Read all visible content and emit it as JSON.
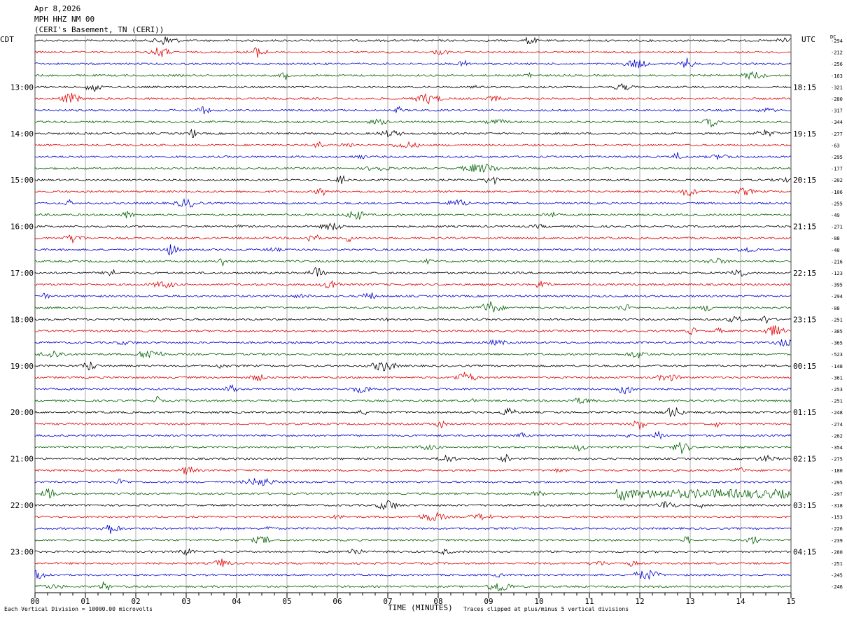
{
  "header": {
    "date": "Apr 8,2026",
    "station": "MPH HHZ NM 00",
    "location": "(CERI's Basement, TN (CERI))"
  },
  "left_tz": "CDT",
  "right_tz": "UTC",
  "dc_label": "DC",
  "colors": [
    "#000000",
    "#e00000",
    "#0000d0",
    "#006000"
  ],
  "chart_data": {
    "type": "line",
    "title": "",
    "xlabel": "TIME (MINUTES)",
    "ylabel": "",
    "xlim": [
      0,
      15
    ],
    "x_ticks": [
      "00",
      "01",
      "02",
      "03",
      "04",
      "05",
      "06",
      "07",
      "08",
      "09",
      "10",
      "11",
      "12",
      "13",
      "14",
      "15"
    ],
    "left_hour_labels": [
      "13:00",
      "14:00",
      "15:00",
      "16:00",
      "17:00",
      "18:00",
      "19:00",
      "20:00",
      "21:00",
      "22:00",
      "23:00"
    ],
    "right_hour_labels": [
      "18:15",
      "19:15",
      "20:15",
      "21:15",
      "22:15",
      "23:15",
      "00:15",
      "01:15",
      "02:15",
      "03:15",
      "04:15"
    ],
    "dc_offsets": [
      "-294",
      "-212",
      "-256",
      "-163",
      "-321",
      "-280",
      "-317",
      "-344",
      "-277",
      "-63",
      "-295",
      "-177",
      "-202",
      "-106",
      "-255",
      "-49",
      "-271",
      "-88",
      "-40",
      "-216",
      "-123",
      "-395",
      "-294",
      "-88",
      "-251",
      "-385",
      "-365",
      "-523",
      "-148",
      "-361",
      "-253",
      "-251",
      "-248",
      "-274",
      "-262",
      "-354",
      "-275",
      "-180",
      "-295",
      "-297",
      "-318",
      "-153",
      "-226",
      "-239",
      "-280",
      "-251",
      "-245",
      "-246"
    ],
    "trace_count": 48,
    "grid": true
  },
  "footer": {
    "left_note": "Each Vertical Division = 10000.00 microvolts",
    "right_note": "Traces clipped at plus/minus 5 vertical divisions"
  }
}
